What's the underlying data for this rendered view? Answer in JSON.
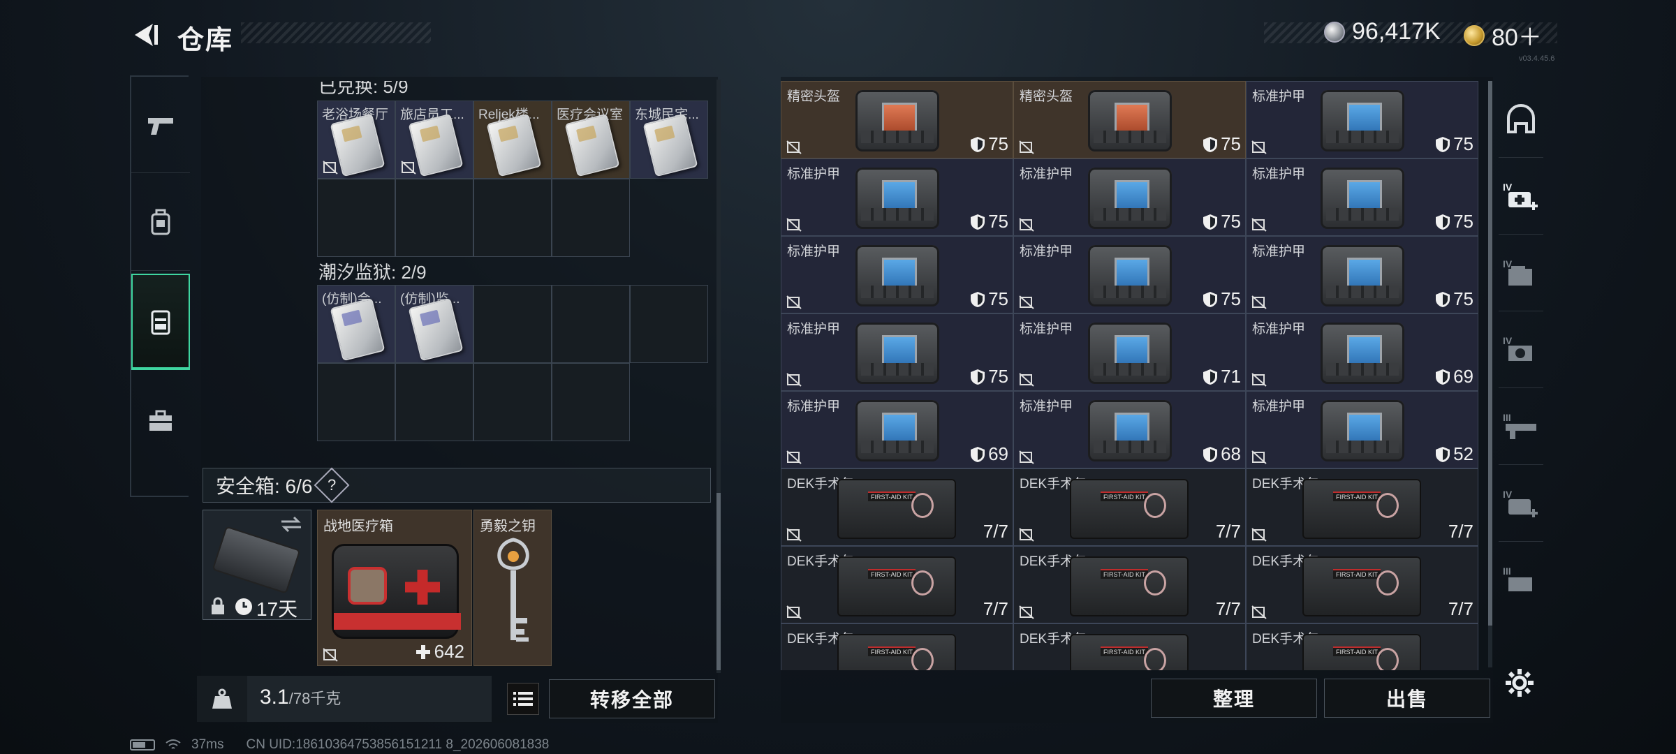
{
  "header": {
    "title": "仓库",
    "silver": "96,417K",
    "gold": "80＋"
  },
  "version": "v03.4.45.6",
  "left_nav": [
    "weapon-icon",
    "backpack-icon",
    "container-icon",
    "briefcase-icon"
  ],
  "storage1": {
    "label": "已兑换: 5/9",
    "items": [
      "老浴场餐厅",
      "旅店员工...",
      "Reljek楼...",
      "医疗会议室",
      "东城民宅..."
    ]
  },
  "storage2": {
    "label": "潮汐监狱: 2/9",
    "items": [
      "(仿制)会...",
      "(仿制)监..."
    ]
  },
  "safebox": {
    "label": "安全箱: 6/6",
    "help": "?",
    "days": "17天"
  },
  "medkit": {
    "name": "战地医疗箱",
    "value": "642"
  },
  "key": {
    "name": "勇毅之钥"
  },
  "weight": {
    "current": "3.1",
    "max": "/78千克"
  },
  "buttons": {
    "transfer_all": "转移全部",
    "organize": "整理",
    "sell": "出售"
  },
  "grid_items": [
    {
      "name": "精密头盔",
      "val": "75",
      "type": "helmet",
      "bg": "brown"
    },
    {
      "name": "精密头盔",
      "val": "75",
      "type": "helmet",
      "bg": "brown"
    },
    {
      "name": "标准护甲",
      "val": "75",
      "type": "armor",
      "bg": "purple"
    },
    {
      "name": "标准护甲",
      "val": "75",
      "type": "armor",
      "bg": "purple"
    },
    {
      "name": "标准护甲",
      "val": "75",
      "type": "armor",
      "bg": "purple"
    },
    {
      "name": "标准护甲",
      "val": "75",
      "type": "armor",
      "bg": "purple"
    },
    {
      "name": "标准护甲",
      "val": "75",
      "type": "armor",
      "bg": "purple"
    },
    {
      "name": "标准护甲",
      "val": "75",
      "type": "armor",
      "bg": "purple"
    },
    {
      "name": "标准护甲",
      "val": "75",
      "type": "armor",
      "bg": "purple"
    },
    {
      "name": "标准护甲",
      "val": "75",
      "type": "armor",
      "bg": "purple"
    },
    {
      "name": "标准护甲",
      "val": "71",
      "type": "armor",
      "bg": "purple"
    },
    {
      "name": "标准护甲",
      "val": "69",
      "type": "armor",
      "bg": "purple"
    },
    {
      "name": "标准护甲",
      "val": "69",
      "type": "armor",
      "bg": "purple"
    },
    {
      "name": "标准护甲",
      "val": "68",
      "type": "armor",
      "bg": "purple"
    },
    {
      "name": "标准护甲",
      "val": "52",
      "type": "armor",
      "bg": "purple"
    },
    {
      "name": "DEK手术包",
      "val": "7/7",
      "type": "kit",
      "bg": "dark"
    },
    {
      "name": "DEK手术包",
      "val": "7/7",
      "type": "kit",
      "bg": "dark"
    },
    {
      "name": "DEK手术包",
      "val": "7/7",
      "type": "kit",
      "bg": "dark"
    },
    {
      "name": "DEK手术包",
      "val": "7/7",
      "type": "kit",
      "bg": "dark"
    },
    {
      "name": "DEK手术包",
      "val": "7/7",
      "type": "kit",
      "bg": "dark"
    },
    {
      "name": "DEK手术包",
      "val": "7/7",
      "type": "kit",
      "bg": "dark"
    },
    {
      "name": "DEK手术包",
      "val": "",
      "type": "kit",
      "bg": "dark"
    },
    {
      "name": "DEK手术包",
      "val": "",
      "type": "kit",
      "bg": "dark"
    },
    {
      "name": "DEK手术包",
      "val": "",
      "type": "kit",
      "bg": "dark"
    }
  ],
  "right_nav": [
    "helmet-slot-icon",
    "medical-iv-icon",
    "ammo-iv-icon",
    "scope-iv-icon",
    "weapon-iii-icon",
    "medical-iv-2-icon",
    "ammo-iii-icon"
  ],
  "status": {
    "ping": "37ms",
    "uid": "CN UID:18610364753856151211 8_202606081838"
  }
}
